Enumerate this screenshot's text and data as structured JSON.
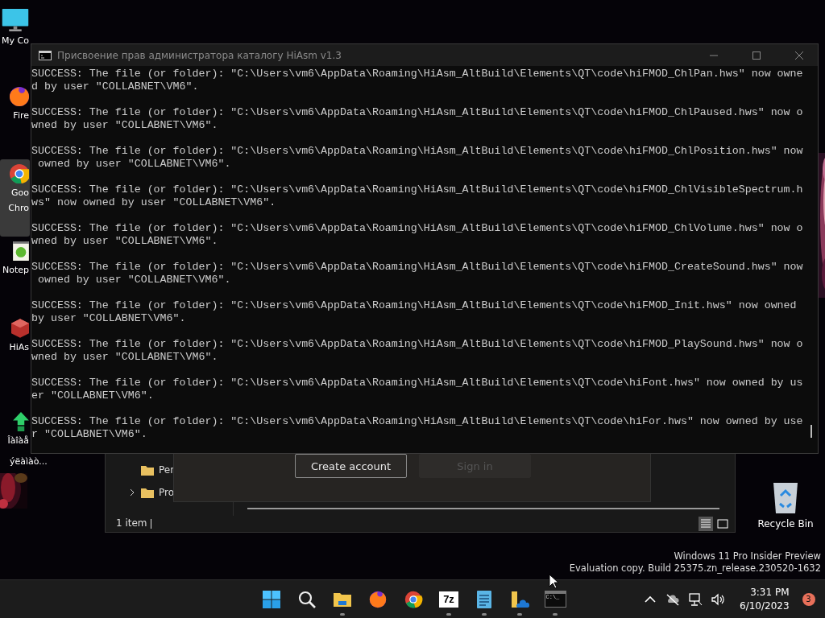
{
  "desktop_icons": [
    {
      "kind": "monitor",
      "label_lines": [
        "My Co"
      ],
      "selected": false
    },
    {
      "kind": "firefox",
      "label_lines": [
        "Fire"
      ],
      "selected": false
    },
    {
      "kind": "chrome",
      "label_lines": [
        "Goo",
        "Chro"
      ],
      "selected": true
    },
    {
      "kind": "notepad",
      "label_lines": [
        "Notep"
      ],
      "selected": false
    },
    {
      "kind": "hiasm",
      "label_lines": [
        "HiAs"
      ],
      "selected": false
    },
    {
      "kind": "installer",
      "label_lines": [
        "Îàîàå",
        "ýëàìàò..."
      ],
      "selected": false
    }
  ],
  "recycle_bin": {
    "label": "Recycle Bin"
  },
  "explorer": {
    "tree": [
      {
        "label": "Per",
        "expandable": false
      },
      {
        "label": "Pro",
        "expandable": true
      }
    ],
    "status": "1 item",
    "views": [
      {
        "kind": "details",
        "selected": true
      },
      {
        "kind": "tiles",
        "selected": false
      }
    ]
  },
  "dialog": {
    "buttons": [
      {
        "label": "Create account",
        "disabled": false
      },
      {
        "label": "Sign in",
        "disabled": true
      }
    ]
  },
  "console": {
    "title": "Присвоение прав администратора каталогу HiAsm v1.3",
    "output": [
      [
        "SUCCESS: The file (or folder): \"C:\\Users\\vm6\\AppData\\Roaming\\HiAsm_AltBuild\\Elements\\QT\\code\\hiFMOD_ChlPan.hws\" now owne",
        "d by user \"COLLABNET\\VM6\"."
      ],
      [
        "SUCCESS: The file (or folder): \"C:\\Users\\vm6\\AppData\\Roaming\\HiAsm_AltBuild\\Elements\\QT\\code\\hiFMOD_ChlPaused.hws\" now o",
        "wned by user \"COLLABNET\\VM6\"."
      ],
      [
        "SUCCESS: The file (or folder): \"C:\\Users\\vm6\\AppData\\Roaming\\HiAsm_AltBuild\\Elements\\QT\\code\\hiFMOD_ChlPosition.hws\" now",
        " owned by user \"COLLABNET\\VM6\"."
      ],
      [
        "SUCCESS: The file (or folder): \"C:\\Users\\vm6\\AppData\\Roaming\\HiAsm_AltBuild\\Elements\\QT\\code\\hiFMOD_ChlVisibleSpectrum.h",
        "ws\" now owned by user \"COLLABNET\\VM6\"."
      ],
      [
        "SUCCESS: The file (or folder): \"C:\\Users\\vm6\\AppData\\Roaming\\HiAsm_AltBuild\\Elements\\QT\\code\\hiFMOD_ChlVolume.hws\" now o",
        "wned by user \"COLLABNET\\VM6\"."
      ],
      [
        "SUCCESS: The file (or folder): \"C:\\Users\\vm6\\AppData\\Roaming\\HiAsm_AltBuild\\Elements\\QT\\code\\hiFMOD_CreateSound.hws\" now",
        " owned by user \"COLLABNET\\VM6\"."
      ],
      [
        "SUCCESS: The file (or folder): \"C:\\Users\\vm6\\AppData\\Roaming\\HiAsm_AltBuild\\Elements\\QT\\code\\hiFMOD_Init.hws\" now owned",
        "by user \"COLLABNET\\VM6\"."
      ],
      [
        "SUCCESS: The file (or folder): \"C:\\Users\\vm6\\AppData\\Roaming\\HiAsm_AltBuild\\Elements\\QT\\code\\hiFMOD_PlaySound.hws\" now o",
        "wned by user \"COLLABNET\\VM6\"."
      ],
      [
        "SUCCESS: The file (or folder): \"C:\\Users\\vm6\\AppData\\Roaming\\HiAsm_AltBuild\\Elements\\QT\\code\\hiFont.hws\" now owned by us",
        "er \"COLLABNET\\VM6\"."
      ],
      [
        "SUCCESS: The file (or folder): \"C:\\Users\\vm6\\AppData\\Roaming\\HiAsm_AltBuild\\Elements\\QT\\code\\hiFor.hws\" now owned by use",
        "r \"COLLABNET\\VM6\"."
      ]
    ]
  },
  "watermark": [
    "Windows 11 Pro Insider Preview",
    "Evaluation copy. Build 25375.zn_release.230520-1632"
  ],
  "taskbar": {
    "apps": [
      {
        "kind": "start",
        "running": false
      },
      {
        "kind": "search",
        "running": false
      },
      {
        "kind": "folder",
        "running": true
      },
      {
        "kind": "firefox",
        "running": false
      },
      {
        "kind": "chrome",
        "running": false
      },
      {
        "kind": "sevenzip",
        "running": true
      },
      {
        "kind": "notepad",
        "running": true
      },
      {
        "kind": "folder-cloud",
        "running": true
      },
      {
        "kind": "terminal",
        "running": true
      }
    ],
    "sevenzip_label": "7z",
    "terminal_label": "C:\\_",
    "time": "3:31 PM",
    "date": "6/10/2023",
    "notifications": "3"
  }
}
